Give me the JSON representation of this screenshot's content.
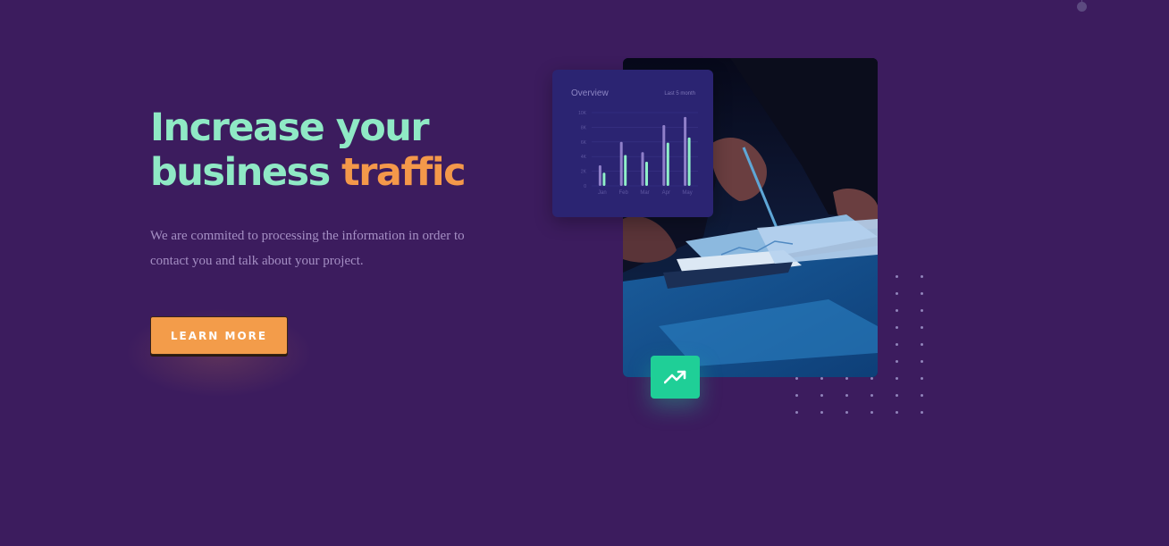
{
  "hero": {
    "title_line1": "Increase your",
    "title_line2_plain": "business ",
    "title_line2_accent": "traffic",
    "description": "We are commited to processing the information in order to contact you and talk about your project.",
    "cta_label": "LEARN MORE"
  },
  "overview_card": {
    "title": "Overview",
    "period": "Last 5 month",
    "chart_data": {
      "type": "bar",
      "categories": [
        "Jan",
        "Feb",
        "Mar",
        "Apr",
        "May"
      ],
      "y_ticks": [
        "10K",
        "8K",
        "6K",
        "4K",
        "2K",
        "0"
      ],
      "ylim": [
        0,
        10000
      ],
      "series": [
        {
          "values": [
            2800,
            6000,
            4600,
            8300,
            9400
          ]
        },
        {
          "values": [
            1800,
            4200,
            3300,
            5900,
            6600
          ]
        }
      ]
    }
  },
  "trend_badge": {
    "icon": "trending-up-icon"
  },
  "colors": {
    "background": "#3c1c5e",
    "title": "#8fe9c5",
    "accent": "#f4984a",
    "badge": "#1fcf97",
    "card": "#2b2472"
  }
}
